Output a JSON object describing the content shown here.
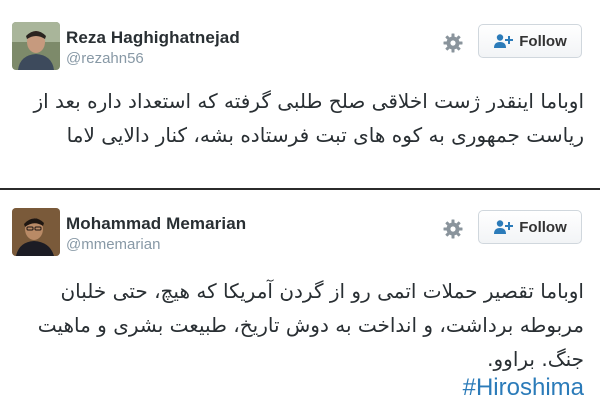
{
  "tweets": [
    {
      "name": "Reza Haghighatnejad",
      "handle": "@rezahn56",
      "follow_label": "Follow",
      "text": "اوباما اینقدر ژست اخلاقی صلح طلبی گرفته که استعداد داره بعد از ریاست جمهوری به کوه های تبت فرستاده بشه، کنار دالایی لاما"
    },
    {
      "name": "Mohammad Memarian",
      "handle": "@mmemarian",
      "follow_label": "Follow",
      "text": "اوباما تقصیر حملات اتمی رو از گردن آمریکا که هیچ، حتی خلبان مربوطه برداشت، و انداخت به دوش تاریخ، طبیعت بشری و ماهیت جنگ. براوو.",
      "hashtag": "#Hiroshima"
    }
  ],
  "colors": {
    "name": "#292f33",
    "handle": "#8899a6",
    "hashtag": "#2b7bb9",
    "follow_text": "#333333",
    "follow_border": "#d0d7dd",
    "divider": "#2b2b2b"
  },
  "icons": [
    "gear-icon",
    "follow-user-plus-icon",
    "avatar-photo"
  ]
}
